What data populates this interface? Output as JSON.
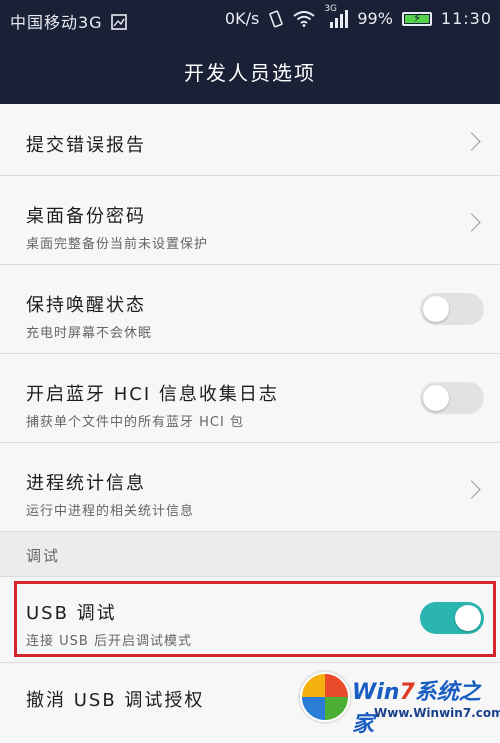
{
  "status_bar": {
    "carrier": "中国移动3G",
    "speed": "0K/s",
    "network": "3G",
    "battery": "99%",
    "time": "11:30",
    "icons": [
      "image-icon",
      "vibrate-icon",
      "wifi-icon",
      "signal-icon",
      "battery-charging-icon"
    ]
  },
  "header": {
    "title": "开发人员选项"
  },
  "items": [
    {
      "title": "提交错误报告",
      "subtitle": "",
      "control": "chevron"
    },
    {
      "title": "桌面备份密码",
      "subtitle": "桌面完整备份当前未设置保护",
      "control": "chevron"
    },
    {
      "title": "保持唤醒状态",
      "subtitle": "充电时屏幕不会休眠",
      "control": "toggle",
      "on": false
    },
    {
      "title": "开启蓝牙 HCI 信息收集日志",
      "subtitle": "捕获单个文件中的所有蓝牙 HCI 包",
      "control": "toggle",
      "on": false
    },
    {
      "title": "进程统计信息",
      "subtitle": "运行中进程的相关统计信息",
      "control": "chevron"
    }
  ],
  "section": {
    "title": "调试"
  },
  "debug_items": [
    {
      "title": "USB 调试",
      "subtitle": "连接 USB 后开启调试模式",
      "control": "toggle",
      "on": true
    },
    {
      "title": "撤消 USB 调试授权",
      "subtitle": "",
      "control": "none"
    }
  ],
  "watermark": {
    "brand_a": "Win",
    "brand_7": "7",
    "brand_b": "系统之家",
    "site": "Www.Winwin7.com"
  },
  "colors": {
    "bar": "#1a2035",
    "toggle_on": "#2bb5b0",
    "highlight": "#d3262d"
  }
}
